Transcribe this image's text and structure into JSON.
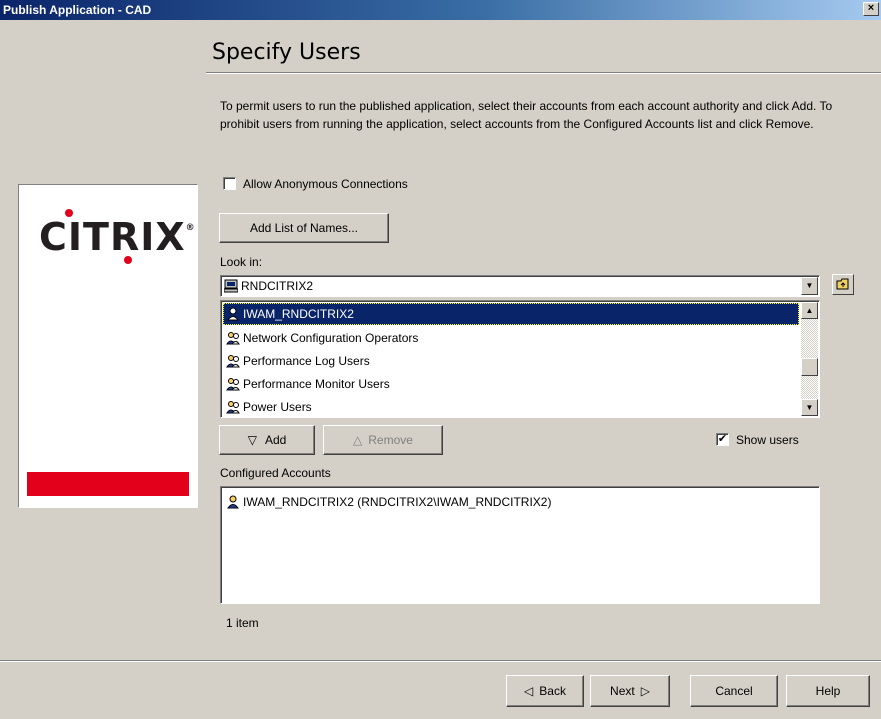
{
  "window": {
    "title": "Publish Application - CAD",
    "close_glyph": "×"
  },
  "page": {
    "heading": "Specify Users",
    "instructions": "To permit users to run the published application, select their accounts from each account authority and click Add.  To prohibit users from running the application, select accounts from the Configured Accounts list and click Remove."
  },
  "logo": {
    "text": "CITRIX",
    "reg": "®",
    "brand_color": "#e2001a"
  },
  "anonymous": {
    "label": "Allow Anonymous Connections",
    "checked": false
  },
  "add_list_button": "Add List of Names...",
  "look_in": {
    "label": "Look in:",
    "value": "RNDCITRIX2",
    "icon": "computer-icon",
    "folder_icon": "folder-up-icon"
  },
  "accounts_list": [
    {
      "label": "IWAM_RNDCITRIX2",
      "icon": "user-icon",
      "selected": true
    },
    {
      "label": "Network Configuration Operators",
      "icon": "group-icon",
      "selected": false
    },
    {
      "label": "Performance Log Users",
      "icon": "group-icon",
      "selected": false
    },
    {
      "label": "Performance Monitor Users",
      "icon": "group-icon",
      "selected": false
    },
    {
      "label": "Power Users",
      "icon": "group-icon",
      "selected": false
    }
  ],
  "add_button": {
    "glyph": "▽",
    "label": "Add"
  },
  "remove_button": {
    "glyph": "△",
    "label": "Remove"
  },
  "show_users": {
    "label": "Show users",
    "checked": true
  },
  "configured": {
    "label": "Configured Accounts",
    "items": [
      {
        "label": "IWAM_RNDCITRIX2 (RNDCITRIX2\\IWAM_RNDCITRIX2)",
        "icon": "user-icon"
      }
    ],
    "count": "1 item"
  },
  "footer": {
    "back": "Back",
    "back_glyph": "◁",
    "next": "Next",
    "next_glyph": "▷",
    "cancel": "Cancel",
    "help": "Help"
  },
  "colors": {
    "selection": "#0a246a",
    "titlebar": "#0a246a",
    "face": "#d4d0c8"
  }
}
